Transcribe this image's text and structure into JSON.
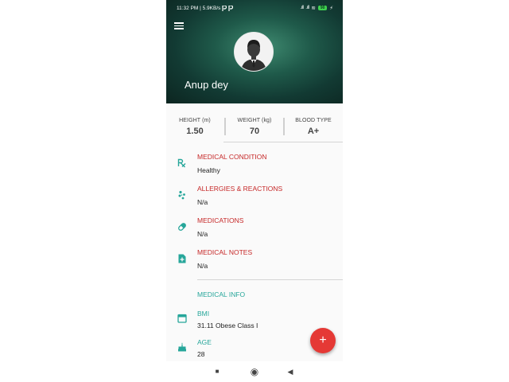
{
  "status_bar": {
    "time": "11:32 PM | 5.9KB/s",
    "signal_1": ".ıll",
    "signal_2": ".ıll",
    "wifi": "≋",
    "battery": "90",
    "charge": "⚡"
  },
  "header": {
    "user_name": "Anup dey"
  },
  "stats": [
    {
      "label": "HEIGHT (m)",
      "value": "1.50"
    },
    {
      "label": "WEIGHT (kg)",
      "value": "70"
    },
    {
      "label": "BLOOD TYPE",
      "value": "A+"
    }
  ],
  "medical": [
    {
      "icon": "rx-icon",
      "title": "MEDICAL CONDITION",
      "value": "Healthy"
    },
    {
      "icon": "pollen-icon",
      "title": "ALLERGIES & REACTIONS",
      "value": "N/a"
    },
    {
      "icon": "pill-icon",
      "title": "MEDICATIONS",
      "value": "N/a"
    },
    {
      "icon": "note-add-icon",
      "title": "MEDICAL NOTES",
      "value": "N/a"
    }
  ],
  "info": {
    "section_title": "MEDICAL INFO",
    "items": [
      {
        "icon": "calendar-icon",
        "title": "BMI",
        "value": "31.11 Obese Class I"
      },
      {
        "icon": "cake-icon",
        "title": "AGE",
        "value": "28"
      }
    ]
  },
  "fab": {
    "label": "+"
  },
  "nav": {
    "recents": "■",
    "home": "◉",
    "back": "◀"
  },
  "colors": {
    "accent_red": "#c62828",
    "accent_teal": "#26a69a",
    "fab": "#e53935"
  }
}
